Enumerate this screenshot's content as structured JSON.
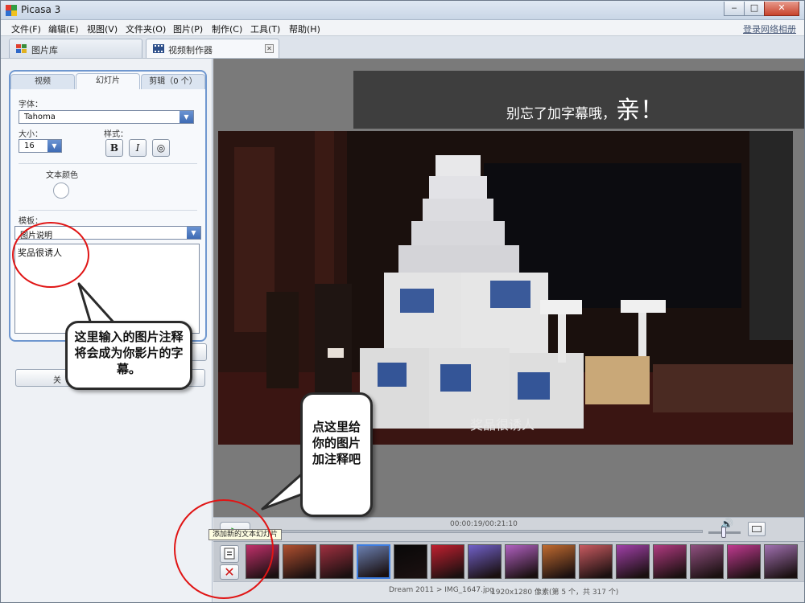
{
  "window": {
    "title": "Picasa 3",
    "controls": [
      "‒",
      "□",
      "✕"
    ]
  },
  "menubar": {
    "items": [
      "文件(F)",
      "编辑(E)",
      "视图(V)",
      "文件夹(O)",
      "图片(P)",
      "制作(C)",
      "工具(T)",
      "帮助(H)"
    ],
    "login_link": "登录网络相册"
  },
  "tabs": [
    {
      "label": "图片库",
      "icon": "library-icon"
    },
    {
      "label": "视频制作器",
      "icon": "film-icon",
      "close": "✕"
    }
  ],
  "panel": {
    "tabs": [
      "视频",
      "幻灯片",
      "剪辑（0 个）"
    ],
    "active_tab": "幻灯片",
    "font_label": "字体：",
    "font_value": "Tahoma",
    "size_label": "大小：",
    "size_value": "16",
    "style_label": "样式：",
    "style_buttons": [
      "B",
      "I",
      "◎"
    ],
    "text_color_label": "文本颜色",
    "template_label": "模板：",
    "template_value": "图片说明",
    "textarea_value": "奖品很诱人",
    "close_button_fragment": "关"
  },
  "callouts": {
    "left": "这里输入的图片注释将会成为你影片的字幕。",
    "center": "点这里给你的图片加注释吧"
  },
  "stage": {
    "caption_prefix": "别忘了加字幕哦，",
    "caption_big": "亲！",
    "photo_caption": "奖品很诱人"
  },
  "controls": {
    "play": "▶",
    "time": "00:00:19/00:21:10",
    "progress": 0.015,
    "volume_icon": "🔊"
  },
  "filmstrip": {
    "tooltip": "添加新的文本幻灯片",
    "thumb_colors": [
      "#c0306a",
      "#b05030",
      "#a03040",
      "#6a7fb0",
      "#080808",
      "#c02030",
      "#7060c8",
      "#b060c0",
      "#c06a30",
      "#c85a60",
      "#a040a8",
      "#b03a80",
      "#905080",
      "#c03a90",
      "#a070b0"
    ],
    "selected_index": 3
  },
  "status": {
    "path": "Dream 2011 > IMG_1647.jpg",
    "dimensions": "1920x1280 像素",
    "count": "(第 5 个，共 317 个)"
  },
  "colors": {
    "accent": "#6f97cf",
    "annotation_red": "#e01515"
  }
}
